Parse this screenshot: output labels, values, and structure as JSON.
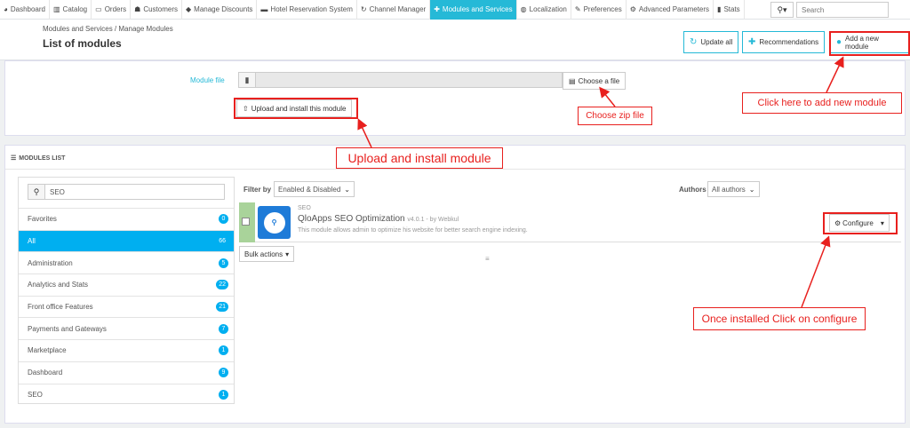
{
  "topnav": {
    "items": [
      {
        "label": "Dashboard",
        "icon": "dashboard-icon",
        "glyph": "◕"
      },
      {
        "label": "Catalog",
        "icon": "book-icon",
        "glyph": "▥"
      },
      {
        "label": "Orders",
        "icon": "credit-card-icon",
        "glyph": "▭"
      },
      {
        "label": "Customers",
        "icon": "users-icon",
        "glyph": "☗"
      },
      {
        "label": "Manage Discounts",
        "icon": "tag-icon",
        "glyph": "◆"
      },
      {
        "label": "Hotel Reservation System",
        "icon": "bed-icon",
        "glyph": "▬"
      },
      {
        "label": "Channel Manager",
        "icon": "refresh-icon",
        "glyph": "↻"
      },
      {
        "label": "Modules and Services",
        "icon": "puzzle-icon",
        "glyph": "✚",
        "active": true
      },
      {
        "label": "Localization",
        "icon": "globe-icon",
        "glyph": "◍"
      },
      {
        "label": "Preferences",
        "icon": "wrench-icon",
        "glyph": "✎"
      },
      {
        "label": "Advanced Parameters",
        "icon": "cogs-icon",
        "glyph": "⚙"
      },
      {
        "label": "Stats",
        "icon": "bar-chart-icon",
        "glyph": "▮"
      }
    ],
    "search_placeholder": "Search",
    "search_btn_caret": "▾"
  },
  "header": {
    "breadcrumb": "Modules and Services   /   Manage Modules",
    "title": "List of modules",
    "update_all": "Update all",
    "recommendations": "Recommendations",
    "add_new_module": "Add a new module"
  },
  "upload": {
    "file_label": "Module file",
    "choose_file": "Choose a file",
    "upload_install": "Upload and install this module"
  },
  "modules_list": {
    "heading": "MODULES LIST",
    "search_value": "SEO",
    "categories": [
      {
        "label": "Favorites",
        "count": "0"
      },
      {
        "label": "All",
        "count": "66",
        "active": true
      },
      {
        "label": "Administration",
        "count": "5"
      },
      {
        "label": "Analytics and Stats",
        "count": "22"
      },
      {
        "label": "Front office Features",
        "count": "21"
      },
      {
        "label": "Payments and Gateways",
        "count": "7"
      },
      {
        "label": "Marketplace",
        "count": "1"
      },
      {
        "label": "Dashboard",
        "count": "9"
      },
      {
        "label": "SEO",
        "count": "1"
      }
    ],
    "filter_by_label": "Filter by",
    "filter_value": "Enabled & Disabled",
    "authors_label": "Authors",
    "authors_value": "All authors",
    "module": {
      "category": "SEO",
      "name": "QloApps SEO Optimization",
      "version": "v4.0.1 - by Webkul",
      "description": "This module allows admin to optimize his website for better search engine indexing.",
      "configure": "Configure"
    },
    "bulk_actions": "Bulk actions"
  },
  "annotations": {
    "add_new": "Click here to add new module",
    "choose_zip": "Choose zip file",
    "upload_install": "Upload and install module",
    "configure": "Once installed Click on configure"
  },
  "colors": {
    "accent": "#25b9d7",
    "annotation": "#e8201e",
    "active_category": "#00aff0",
    "enabled_bar": "#a9d39a"
  }
}
